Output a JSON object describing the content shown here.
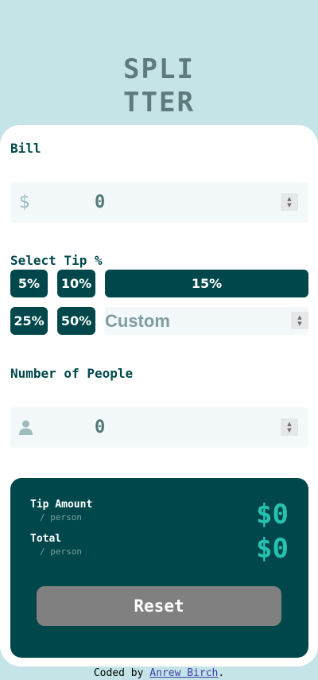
{
  "logo": {
    "line1": "SPLI",
    "line2": "TTER"
  },
  "bill": {
    "label": "Bill",
    "currency_icon": "dollar-icon",
    "currency_symbol": "$",
    "value": "0"
  },
  "tip": {
    "label": "Select Tip %",
    "options": [
      "5%",
      "10%",
      "15%",
      "25%",
      "50%"
    ],
    "custom_placeholder": "Custom"
  },
  "people": {
    "label": "Number of People",
    "icon": "person-icon",
    "value": "0"
  },
  "results": {
    "tip_label": "Tip Amount",
    "tip_sub": "/ person",
    "tip_value": "$0",
    "total_label": "Total",
    "total_sub": "/ person",
    "total_value": "$0",
    "reset_label": "Reset"
  },
  "footer": {
    "prefix": "Coded by ",
    "author": "Anrew Birch",
    "suffix": "."
  },
  "colors": {
    "background": "#c5e4e7",
    "dark_cyan": "#00474b",
    "accent": "#26c2ae",
    "input_bg": "#f3f9fa",
    "reset_disabled": "#808080"
  }
}
